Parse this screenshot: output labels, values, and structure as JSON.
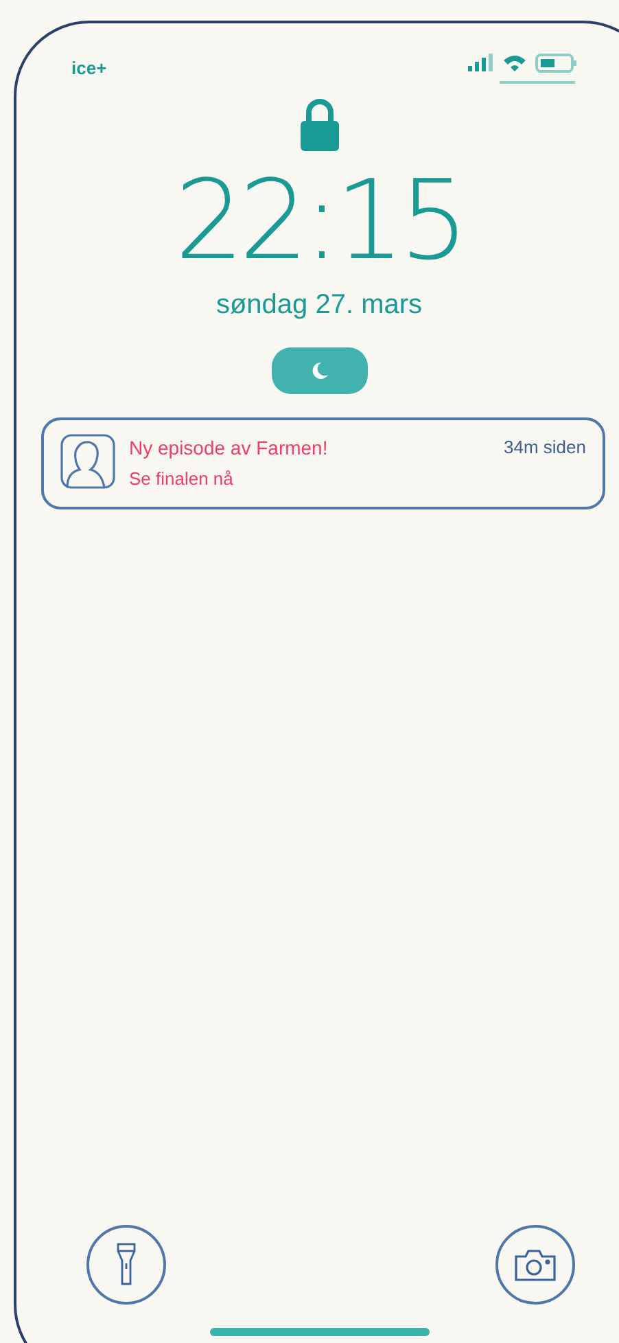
{
  "status_bar": {
    "carrier": "ice+"
  },
  "lock_screen": {
    "time": "22:15",
    "date": "søndag 27. mars",
    "focus_mode": {
      "on": true
    }
  },
  "notifications": [
    {
      "title": "Ny episode av Farmen!",
      "body": "Se finalen nå",
      "time": "34m siden"
    }
  ],
  "quick_actions": [
    {
      "kind": "flashlight"
    },
    {
      "kind": "camera"
    }
  ]
}
